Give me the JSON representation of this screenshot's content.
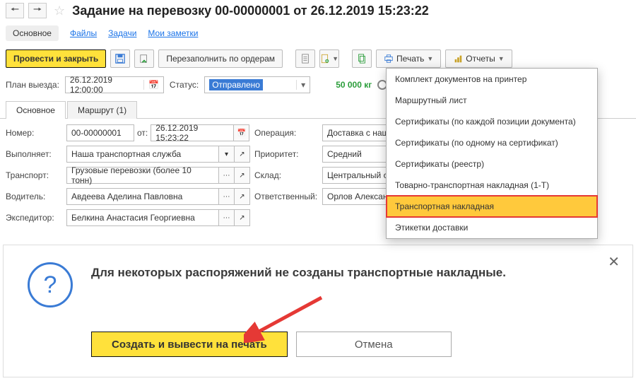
{
  "header": {
    "title": "Задание на перевозку 00-00000001 от 26.12.2019 15:23:22"
  },
  "nav": {
    "main_tab": "Основное",
    "links": [
      "Файлы",
      "Задачи",
      "Мои заметки"
    ]
  },
  "toolbar": {
    "post_close": "Провести и закрыть",
    "refill": "Перезаполнить по ордерам",
    "print": "Печать",
    "reports": "Отчеты"
  },
  "plan": {
    "label": "План выезда:",
    "value": "26.12.2019 12:00:00",
    "status_label": "Статус:",
    "status_value": "Отправлено",
    "weight": "50 000 кг"
  },
  "tabs": [
    "Основное",
    "Маршрут (1)"
  ],
  "form": {
    "number_label": "Номер:",
    "number": "00-00000001",
    "from_label": "от:",
    "from": "26.12.2019 15:23:22",
    "operation_label": "Операция:",
    "operation": "Доставка с наше",
    "performer_label": "Выполняет:",
    "performer": "Наша транспортная служба",
    "priority_label": "Приоритет:",
    "priority": "Средний",
    "transport_label": "Транспорт:",
    "transport": "Грузовые перевозки (более 10 тонн)",
    "warehouse_label": "Склад:",
    "warehouse": "Центральный скл",
    "driver_label": "Водитель:",
    "driver": "Авдеева Аделина Павловна",
    "responsible_label": "Ответственный:",
    "responsible": "Орлов Александ",
    "forwarder_label": "Экспедитор:",
    "forwarder": "Белкина Анастасия Георгиевна"
  },
  "print_menu": [
    "Комплект документов на принтер",
    "Маршрутный лист",
    "Сертификаты (по каждой позиции документа)",
    "Сертификаты (по одному на сертификат)",
    "Сертификаты (реестр)",
    "Товарно-транспортная накладная (1-Т)",
    "Транспортная накладная",
    "Этикетки доставки"
  ],
  "dialog": {
    "text": "Для некоторых распоряжений не созданы транспортные накладные.",
    "ok": "Создать и вывести на печать",
    "cancel": "Отмена"
  }
}
